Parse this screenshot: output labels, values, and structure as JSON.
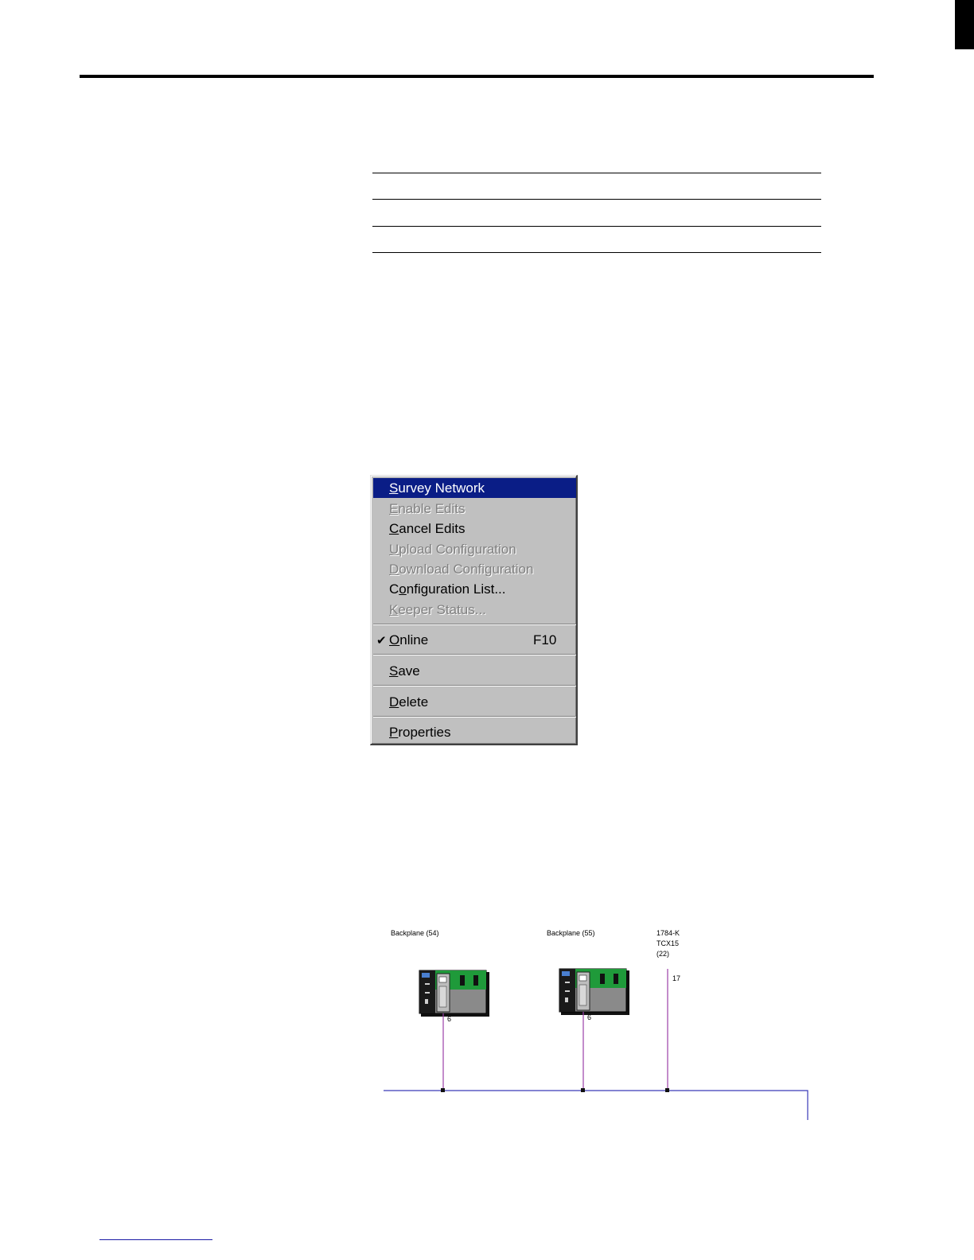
{
  "menu": {
    "items": [
      {
        "pre": "",
        "u": "S",
        "post": "urvey Network",
        "state": "selected"
      },
      {
        "pre": "",
        "u": "E",
        "post": "nable Edits",
        "state": "disabled"
      },
      {
        "pre": "",
        "u": "C",
        "post": "ancel Edits",
        "state": "enabled"
      },
      {
        "pre": "",
        "u": "U",
        "post": "pload Configuration",
        "state": "disabled"
      },
      {
        "pre": "",
        "u": "D",
        "post": "ownload Configuration",
        "state": "disabled"
      },
      {
        "pre": "C",
        "u": "o",
        "post": "nfiguration List...",
        "state": "enabled"
      },
      {
        "pre": "",
        "u": "K",
        "post": "eeper Status...",
        "state": "disabled"
      }
    ],
    "online": {
      "check": "✔",
      "pre": "",
      "u": "O",
      "post": "nline",
      "shortcut": "F10"
    },
    "save": {
      "pre": "",
      "u": "S",
      "post": "ave"
    },
    "delete": {
      "pre": "",
      "u": "D",
      "post": "elete"
    },
    "properties": {
      "pre": "",
      "u": "P",
      "post": "roperties"
    }
  },
  "diagram": {
    "node1": {
      "label": "Backplane (54)",
      "port": "6"
    },
    "node2": {
      "label": "Backplane (55)",
      "port": "6"
    },
    "node3": {
      "label_lines": [
        "1784-K",
        "TCX15",
        "(22)"
      ],
      "port": "17"
    },
    "colors": {
      "bus": "#3a3ab8",
      "drop": "#9b3fa8",
      "chassis_green": "#1f9a3a",
      "chassis_gray": "#8a8a8a"
    }
  }
}
